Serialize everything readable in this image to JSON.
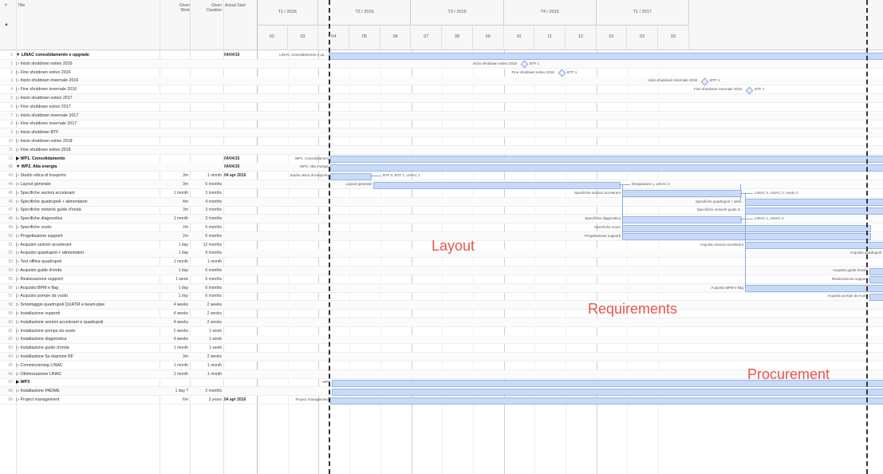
{
  "header": {
    "col_num": "#",
    "col_title": "Title",
    "col_work": "Given Work",
    "col_duration": "Given Duration",
    "col_start": "Actual Start",
    "sort_icon": "triangle-up-icon",
    "quarters": [
      "T1 / 2016",
      "T2 / 2016",
      "T3 / 2016",
      "T4 / 2016",
      "T1 / 2017"
    ],
    "months": [
      "02",
      "03",
      "04",
      "05",
      "06",
      "07",
      "08",
      "09",
      "10",
      "11",
      "12",
      "01",
      "02",
      "03"
    ]
  },
  "rows": [
    {
      "num": "0",
      "title": "▼ LINAC consolidamento e upgrade",
      "work": "",
      "dur": "",
      "start": "04/04/16",
      "bold": true
    },
    {
      "num": "1",
      "title": "▷ Inizio shutdown estivo 2016",
      "work": "",
      "dur": "",
      "start": ""
    },
    {
      "num": "2",
      "title": "▷ Fine shutdown estivo 2016",
      "work": "",
      "dur": "",
      "start": ""
    },
    {
      "num": "3",
      "title": "▷ Inizio shutdown invernale 2016",
      "work": "",
      "dur": "",
      "start": ""
    },
    {
      "num": "4",
      "title": "▷ Fine shutdown invernale 2016",
      "work": "",
      "dur": "",
      "start": ""
    },
    {
      "num": "5",
      "title": "▷ Inizio shutdown estivo 2017",
      "work": "",
      "dur": "",
      "start": ""
    },
    {
      "num": "6",
      "title": "▷ Fine shutdown estivo 2017",
      "work": "",
      "dur": "",
      "start": ""
    },
    {
      "num": "7",
      "title": "▷ Inizio shutdown invernale 2017",
      "work": "",
      "dur": "",
      "start": ""
    },
    {
      "num": "8",
      "title": "▷ Fine shutdown invernale 2017",
      "work": "",
      "dur": "",
      "start": ""
    },
    {
      "num": "9",
      "title": "▷ Inizio shutdown BTF",
      "work": "",
      "dur": "",
      "start": ""
    },
    {
      "num": "10",
      "title": "▷ Inizio shutdown estivo 2018",
      "work": "",
      "dur": "",
      "start": ""
    },
    {
      "num": "11",
      "title": "▷ Fine shutdown estivo 2018",
      "work": "",
      "dur": "",
      "start": ""
    },
    {
      "num": "12",
      "title": "▶ WP1. Consolidamento",
      "work": "",
      "dur": "",
      "start": "04/04/16",
      "bold": true
    },
    {
      "num": "42",
      "title": "▼ WP2. Alta energia",
      "work": "",
      "dur": "",
      "start": "04/04/16",
      "bold": true
    },
    {
      "num": "43",
      "title": "▷ Studio ottica di trasporto",
      "work": "3m",
      "dur": "1 month",
      "start": "04 apr 2016"
    },
    {
      "num": "44",
      "title": "▷ Layout generale",
      "work": "3m",
      "dur": "6 months",
      "start": ""
    },
    {
      "num": "45",
      "title": "▷ Specifiche sezioni accelerant",
      "work": "1 month",
      "dur": "3 months",
      "start": ""
    },
    {
      "num": "46",
      "title": "▷ Specifiche quadrupoli + alimentatori",
      "work": "4m",
      "dur": "4 months",
      "start": ""
    },
    {
      "num": "47",
      "title": "▷ Specifiche network guide d'onda",
      "work": "3m",
      "dur": "3 months",
      "start": ""
    },
    {
      "num": "48",
      "title": "▷ Specifiche diagnostica",
      "work": "1 month",
      "dur": "3 months",
      "start": ""
    },
    {
      "num": "49",
      "title": "▷ Specifiche vuoto",
      "work": "2m",
      "dur": "6 months",
      "start": ""
    },
    {
      "num": "50",
      "title": "▷ Progettazione supporti",
      "work": "2m",
      "dur": "6 months",
      "start": ""
    },
    {
      "num": "51",
      "title": "▷ Acquisto sezioni accelerant",
      "work": "1 day",
      "dur": "12 months",
      "start": ""
    },
    {
      "num": "52",
      "title": "▷ Acquisto quadrupoli + alimentatori",
      "work": "1 day",
      "dur": "9 months",
      "start": ""
    },
    {
      "num": "53",
      "title": "▷ Test offline quadrupoli",
      "work": "1 month",
      "dur": "1 month",
      "start": ""
    },
    {
      "num": "54",
      "title": "▷ Acquisto guide d'onda",
      "work": "1 day",
      "dur": "6 months",
      "start": ""
    },
    {
      "num": "55",
      "title": "▷ Realizzazione supporti",
      "work": "1 week",
      "dur": "6 months",
      "start": ""
    },
    {
      "num": "56",
      "title": "▷ Acquisto BPM e flag",
      "work": "1 day",
      "dur": "6 months",
      "start": ""
    },
    {
      "num": "57",
      "title": "▷ Acquisto pompe da vuoto",
      "work": "1 day",
      "dur": "6 months",
      "start": ""
    },
    {
      "num": "58",
      "title": "▷ Smontaggio quadrupoli QUATM e beam-pipe",
      "work": "4 weeks",
      "dur": "2 weeks",
      "start": ""
    },
    {
      "num": "59",
      "title": "▷ Installazione supporti",
      "work": "4 weeks",
      "dur": "2 weeks",
      "start": ""
    },
    {
      "num": "60",
      "title": "▷ Installazione sezioni accelerant e quadrupoli",
      "work": "4 weeks",
      "dur": "2 weeks",
      "start": ""
    },
    {
      "num": "61",
      "title": "▷ Installazione pompe da vuoto",
      "work": "2 weeks",
      "dur": "1 week",
      "start": ""
    },
    {
      "num": "62",
      "title": "▷ Installazione diagnostica",
      "work": "4 weeks",
      "dur": "1 week",
      "start": ""
    },
    {
      "num": "63",
      "title": "▷ Installazione guide d'onda",
      "work": "1 month",
      "dur": "1 week",
      "start": ""
    },
    {
      "num": "64",
      "title": "▷ Installazione 5a stazione RF",
      "work": "3m",
      "dur": "2 weeks",
      "start": ""
    },
    {
      "num": "65",
      "title": "▷ Commissioning LINAC",
      "work": "1 month",
      "dur": "1 month",
      "start": ""
    },
    {
      "num": "66",
      "title": "▷ Ottimizzazione LINAC",
      "work": "1 month",
      "dur": "1 month",
      "start": ""
    },
    {
      "num": "67",
      "title": "▶ WP3",
      "work": "",
      "dur": "",
      "start": "",
      "bold": true
    },
    {
      "num": "68",
      "title": "▷ Installazione PADME",
      "work": "1 day ?",
      "dur": "2 months",
      "start": ""
    },
    {
      "num": "69",
      "title": "▷ Project management",
      "work": "6m",
      "dur": "3 years",
      "start": "04 apr 2016"
    }
  ],
  "bar_labels": {
    "linac": "LINAC consolidamento e up...",
    "wp1": "WP1. Consolidament",
    "wp2": "WP2. Alta energia",
    "studio": "Studio ottica di trasporto",
    "studio_dep": "BTF 0, BTF 1, LINAC 1",
    "layout": "Layout generale",
    "layout_dep": "Disegnatore 1, LINAC 2",
    "spec_sez": "Specifiche sezioni accelerant",
    "spec_sez_dep": "LINAC 0, LINAC 2, Vuoto 2",
    "spec_quad": "Specifiche quadrupoli + alim...",
    "spec_net": "Specifiche network guide d'...",
    "spec_diag": "Specifiche diagnostica",
    "spec_diag_dep": "LINAC 1, LINAC 2",
    "spec_vuoto": "Specifiche vuoto",
    "prog_supp": "Progettazione supporti",
    "acq_sez": "Acquisto sezioni accelerant",
    "acq_quad": "Acquisto quadrupoli",
    "acq_guide": "Acquisto guide d'onda",
    "real_supp": "Realizzazione supporti",
    "acq_bpm": "Acquisto BPM e flag",
    "acq_pompe": "Acquisto pompe da vuoto",
    "pm": "Project management",
    "wp3": "WP3",
    "m1": "Inizio shutdown estivo 2016",
    "m1_dep": "BTF 1",
    "m2": "Fine shutdown estivo 2016",
    "m2_dep": "BTF 1",
    "m3": "Inizio shutdown invernale 2016",
    "m3_dep": "BTF 1",
    "m4": "Fine shutdown invernale 2016",
    "m4_dep": "BTF 1"
  },
  "annotations": {
    "layout": "Layout",
    "requirements": "Requirements",
    "procurement": "Procurement"
  },
  "colors": {
    "bar_fill": "#c9daf8",
    "annotation": "#e8554e"
  }
}
